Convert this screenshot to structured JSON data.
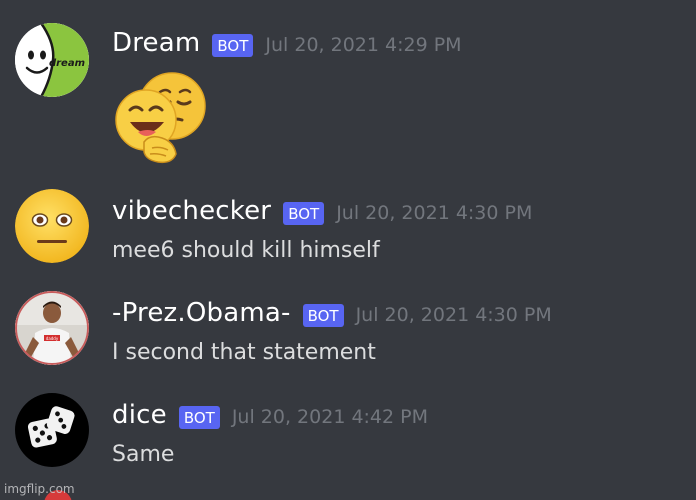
{
  "messages": [
    {
      "username": "Dream",
      "badge": "BOT",
      "timestamp": "Jul 20, 2021 4:29 PM",
      "content": "",
      "avatar_icon": "dream-logo-avatar",
      "avatar_text": "dream",
      "avatar_color": "#8bc53f",
      "emoji": "laughing-face-with-hand-and-relieved-face-emoji"
    },
    {
      "username": "vibechecker",
      "badge": "BOT",
      "timestamp": "Jul 20, 2021 4:30 PM",
      "content": "mee6 should kill himself",
      "avatar_icon": "neutral-face-avatar"
    },
    {
      "username": "-Prez.Obama-",
      "badge": "BOT",
      "timestamp": "Jul 20, 2021 4:30 PM",
      "content": "I second that statement",
      "avatar_icon": "person-photo-avatar"
    },
    {
      "username": "dice",
      "badge": "BOT",
      "timestamp": "Jul 20, 2021 4:42 PM",
      "content": "Same",
      "avatar_icon": "dice-avatar"
    }
  ],
  "watermark": "imgflip.com",
  "colors": {
    "background": "#36393f",
    "bot_badge": "#5865f2",
    "timestamp": "#72767d",
    "message_text": "#dcddde"
  }
}
